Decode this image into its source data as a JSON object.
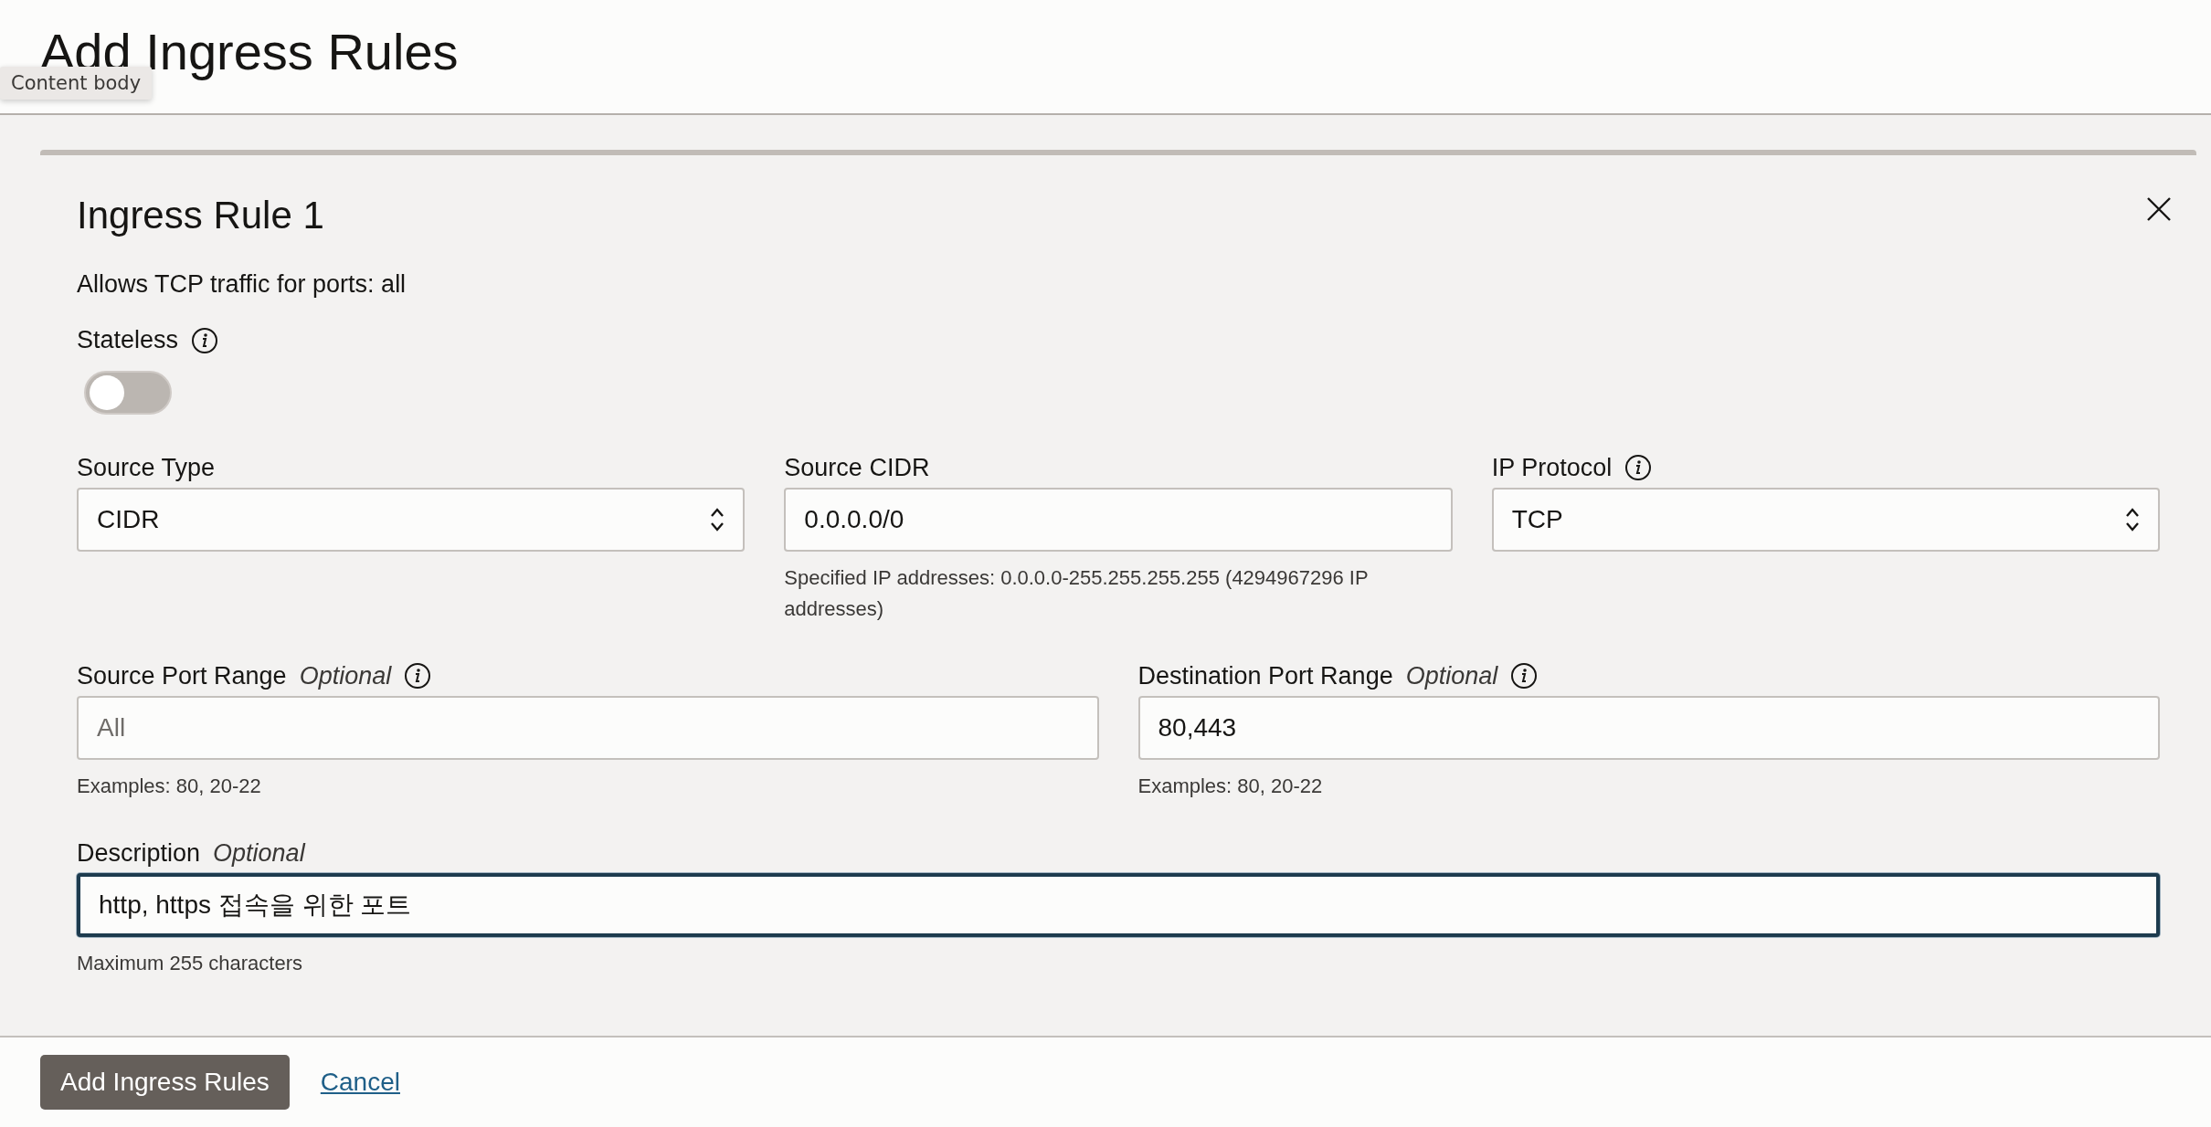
{
  "page": {
    "title": "Add Ingress Rules"
  },
  "tooltip": {
    "text": "Content body"
  },
  "rule": {
    "title": "Ingress Rule 1",
    "summary": "Allows TCP traffic for ports: all",
    "stateless": {
      "label": "Stateless",
      "info": true,
      "on": false
    },
    "rows": [
      [
        {
          "kind": "select",
          "label": "Source Type",
          "info": false,
          "value": "CIDR"
        },
        {
          "kind": "text",
          "label": "Source CIDR",
          "info": false,
          "value": "0.0.0.0/0",
          "helper": "Specified IP addresses: 0.0.0.0-255.255.255.255 (4294967296 IP addresses)"
        },
        {
          "kind": "select",
          "label": "IP Protocol",
          "info": true,
          "value": "TCP"
        }
      ],
      [
        {
          "kind": "text",
          "label": "Source Port Range",
          "optional": "Optional",
          "info": true,
          "placeholder": "All",
          "helper": "Examples: 80, 20-22"
        },
        {
          "kind": "text",
          "label": "Destination Port Range",
          "optional": "Optional",
          "info": true,
          "value": "80,443",
          "helper": "Examples: 80, 20-22"
        }
      ],
      [
        {
          "kind": "text",
          "label": "Description",
          "optional": "Optional",
          "info": false,
          "value": "http, https 접속을 위한 포트",
          "focused": true,
          "helper": "Maximum 255 characters"
        }
      ]
    ]
  },
  "footer": {
    "primary_button": "Add Ingress Rules",
    "cancel_link": "Cancel"
  }
}
